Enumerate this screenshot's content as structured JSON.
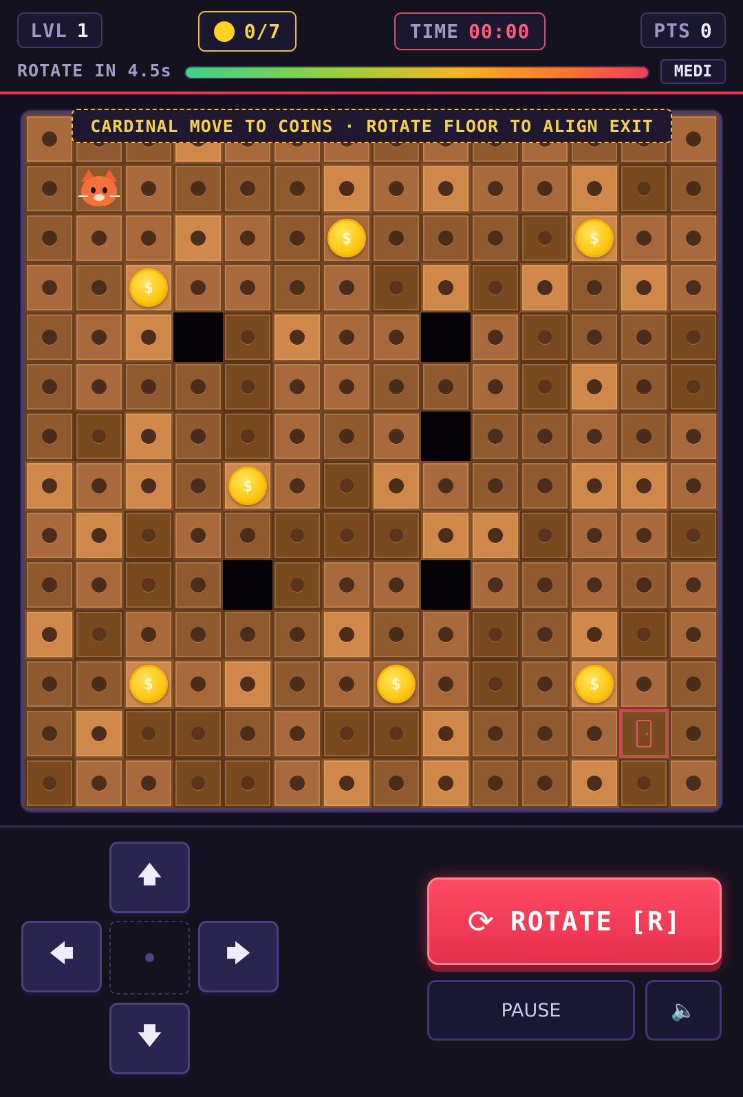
{
  "hud": {
    "level_label": "LVL",
    "level_value": "1",
    "coins_text": "0/7",
    "time_label": "TIME",
    "time_value": "00:00",
    "points_label": "PTS",
    "points_value": "0",
    "rotate_countdown": "ROTATE IN 4.5s",
    "rotate_progress": 1.0,
    "difficulty": "MEDI"
  },
  "instruction": "CARDINAL MOVE TO COINS · ROTATE FLOOR TO ALIGN EXIT",
  "board": {
    "size": 14,
    "tiles": [
      "12201112121221",
      "22122201011032",
      "21101212223011",
      "12011213030201",
      "210X3011X13223",
      "21223112213023",
      "23023121X22121",
      "01020130122001",
      "10312333003113",
      "2132X311X12121",
      "03122202132031",
      "22010211132012",
      "20332133022132",
      "31133102022031"
    ],
    "player": {
      "row": 1,
      "col": 1
    },
    "exit": {
      "row": 12,
      "col": 12
    },
    "coins": [
      {
        "row": 2,
        "col": 6
      },
      {
        "row": 2,
        "col": 11
      },
      {
        "row": 3,
        "col": 2
      },
      {
        "row": 7,
        "col": 4
      },
      {
        "row": 11,
        "col": 2
      },
      {
        "row": 11,
        "col": 7
      },
      {
        "row": 11,
        "col": 11
      }
    ],
    "coin_symbol": "$"
  },
  "controls": {
    "up_icon": "🡅",
    "down_icon": "🡇",
    "left_icon": "🡄",
    "right_icon": "🡆",
    "rotate_label": "ROTATE [R]",
    "rotate_icon": "⟳",
    "pause_label": "PAUSE",
    "sound_icon": "🔈"
  },
  "colors": {
    "accent_red": "#e43a55",
    "coin_gold": "#ffd21e",
    "panel_border": "#3e3765"
  }
}
